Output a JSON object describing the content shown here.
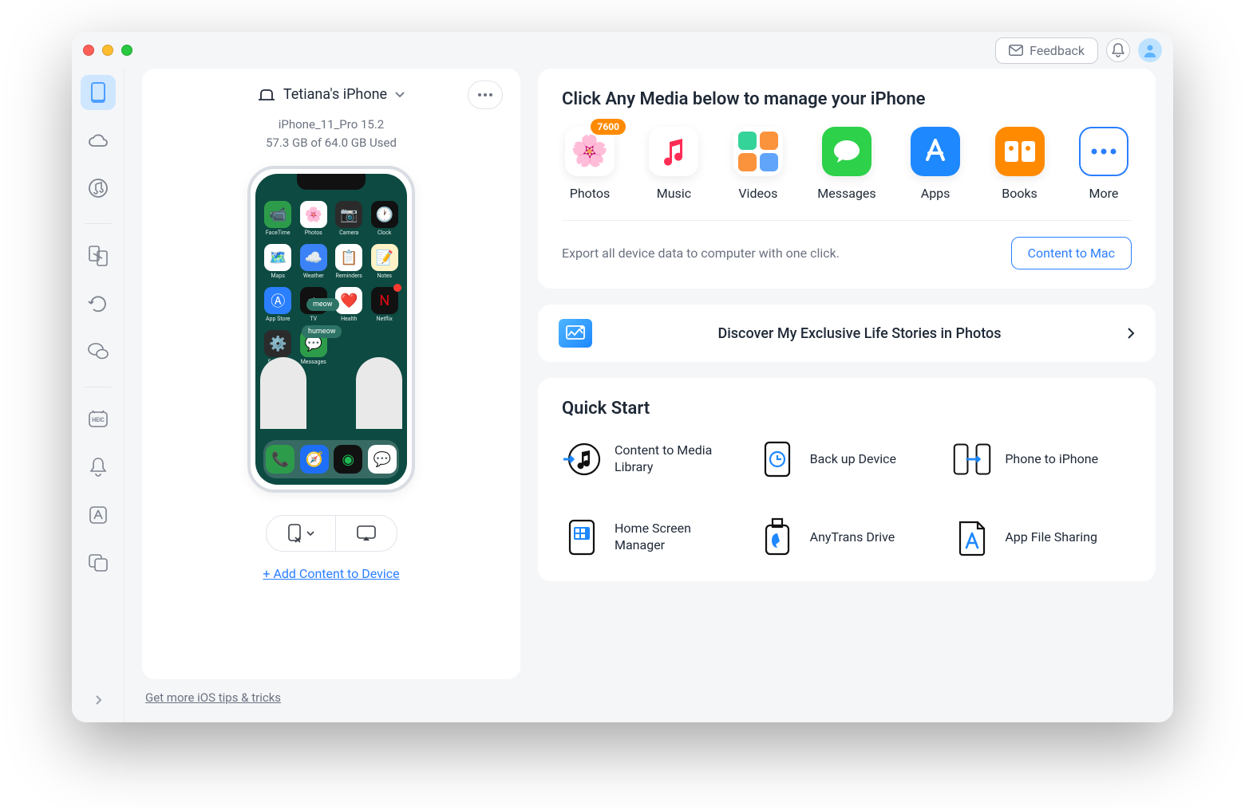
{
  "titlebar": {
    "feedback": "Feedback"
  },
  "device": {
    "name": "Tetiana's iPhone",
    "model": "iPhone_11_Pro 15.2",
    "storage": "57.3 GB of  64.0 GB Used",
    "add_link": "+ Add Content to Device",
    "bubble1": "meow",
    "bubble2": "humeow"
  },
  "tips_link": "Get more iOS tips & tricks",
  "media": {
    "title": "Click Any Media below to manage your iPhone",
    "items": [
      {
        "label": "Photos",
        "badge": "7600"
      },
      {
        "label": "Music"
      },
      {
        "label": "Videos"
      },
      {
        "label": "Messages"
      },
      {
        "label": "Apps"
      },
      {
        "label": "Books"
      },
      {
        "label": "More"
      }
    ],
    "export_text": "Export all device data to computer with one click.",
    "export_button": "Content to Mac"
  },
  "discover": {
    "text": "Discover My Exclusive Life Stories in Photos"
  },
  "quick": {
    "title": "Quick Start",
    "items": [
      {
        "label": "Content to Media Library"
      },
      {
        "label": "Back up Device"
      },
      {
        "label": "Phone to iPhone"
      },
      {
        "label": "Home Screen Manager"
      },
      {
        "label": "AnyTrans Drive"
      },
      {
        "label": "App File Sharing"
      }
    ]
  }
}
